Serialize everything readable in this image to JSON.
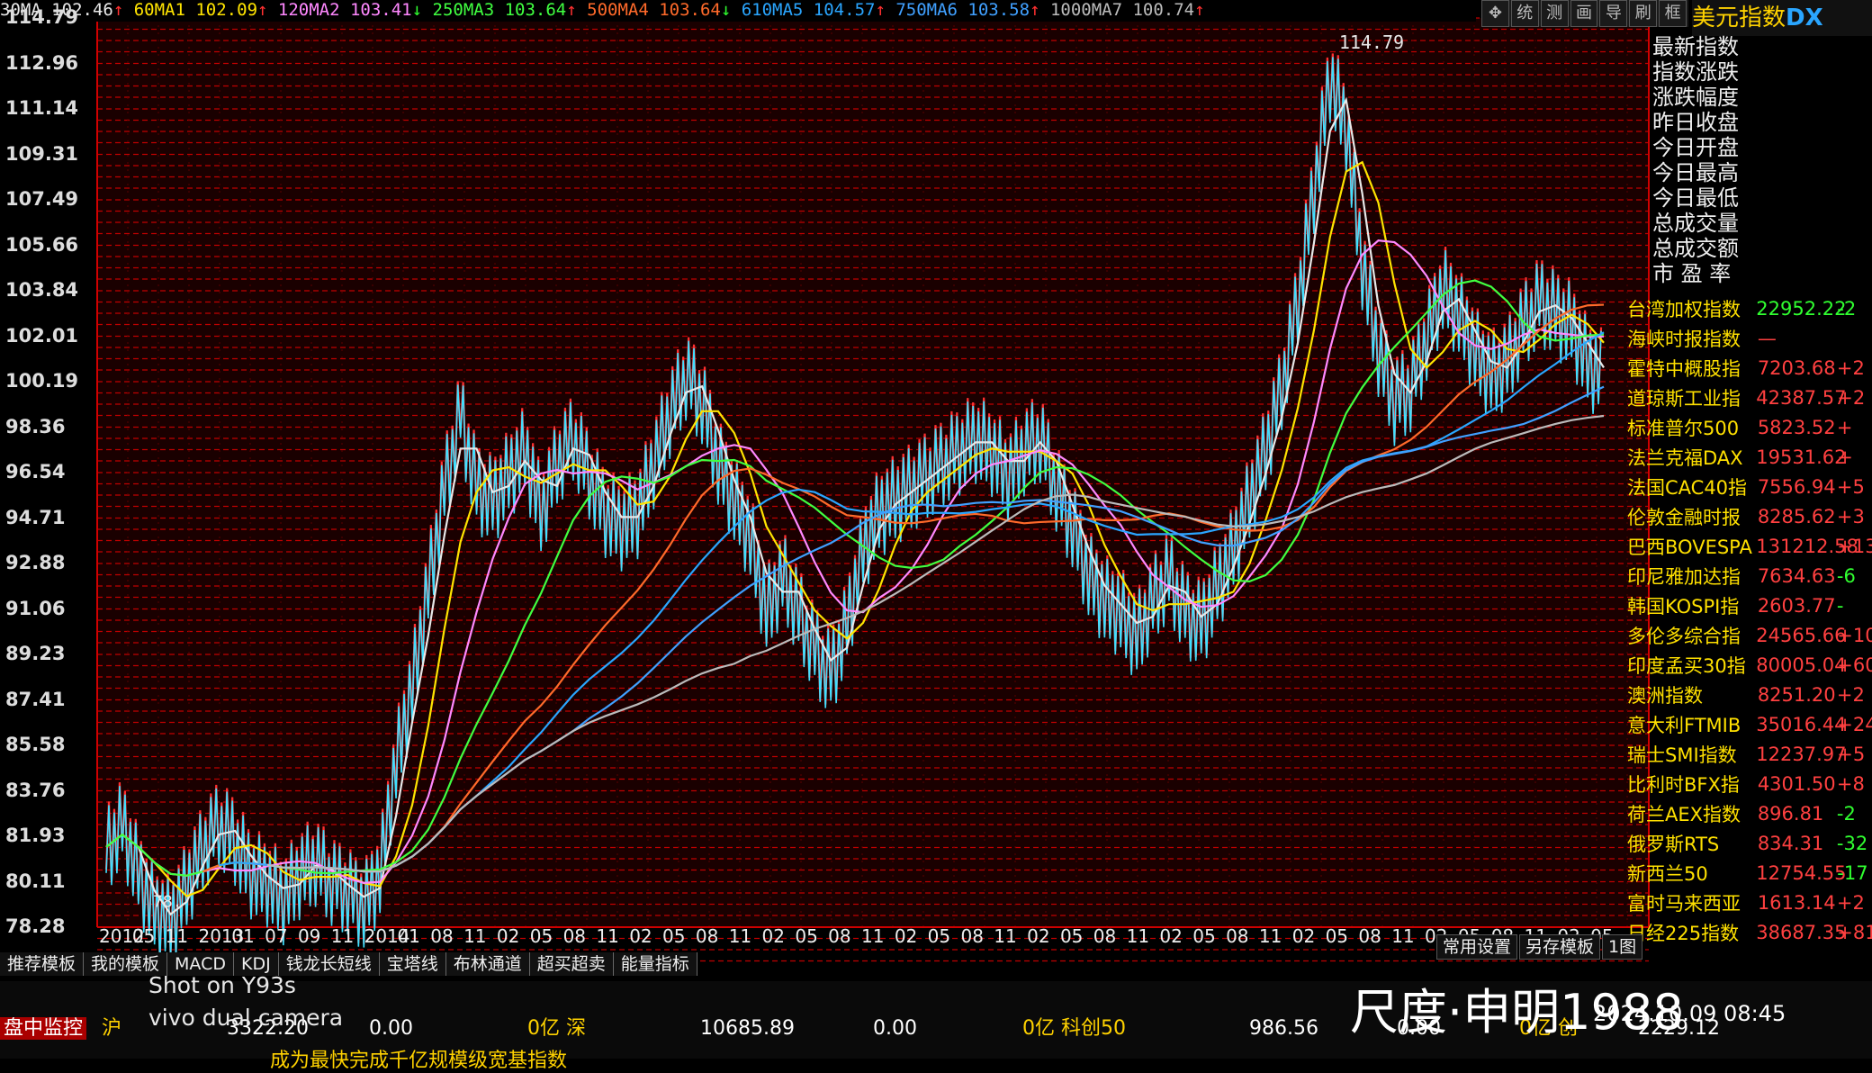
{
  "header": {
    "items": [
      {
        "label": "30MA",
        "value": "102.46",
        "arrow": "↑",
        "color": "#e8e8e8",
        "acolor": "#ff3030"
      },
      {
        "label": "60MA1",
        "value": "102.09",
        "arrow": "↑",
        "color": "#ffe400",
        "acolor": "#ff3030"
      },
      {
        "label": "120MA2",
        "value": "103.41",
        "arrow": "↓",
        "color": "#ff88ff",
        "acolor": "#30ff30"
      },
      {
        "label": "250MA3",
        "value": "103.64",
        "arrow": "↑",
        "color": "#40ff40",
        "acolor": "#ff3030"
      },
      {
        "label": "500MA4",
        "value": "103.64",
        "arrow": "↓",
        "color": "#ff6a2a",
        "acolor": "#30ff30"
      },
      {
        "label": "610MA5",
        "value": "104.57",
        "arrow": "↑",
        "color": "#2aa6ff",
        "acolor": "#ff3030"
      },
      {
        "label": "750MA6",
        "value": "103.58",
        "arrow": "↑",
        "color": "#40a0ff",
        "acolor": "#ff3030"
      },
      {
        "label": "1000MA7",
        "value": "100.74",
        "arrow": "↑",
        "color": "#bbbbbb",
        "acolor": "#ff3030"
      }
    ]
  },
  "toolbar": {
    "icons": [
      "move-icon",
      "统",
      "测",
      "画",
      "导",
      "刷",
      "框"
    ]
  },
  "index_title": {
    "name": "美元指数",
    "code": "DX"
  },
  "info_labels": [
    "最新指数",
    "指数涨跌",
    "涨跌幅度",
    "昨日收盘",
    "今日开盘",
    "今日最高",
    "今日最低",
    "总成交量",
    "总成交额",
    "市 盈 率"
  ],
  "watchlist": [
    {
      "name": "台湾加权指数",
      "value": "22952.22",
      "change": "-2"
    },
    {
      "name": "海峡时报指数",
      "value": "—",
      "change": ""
    },
    {
      "name": "霍特中概股指",
      "value": "7203.68",
      "change": "+2"
    },
    {
      "name": "道琼斯工业指",
      "value": "42387.57",
      "change": "+2"
    },
    {
      "name": "标准普尔500",
      "value": "5823.52",
      "change": "+"
    },
    {
      "name": "法兰克福DAX",
      "value": "19531.62",
      "change": "+"
    },
    {
      "name": "法国CAC40指",
      "value": "7556.94",
      "change": "+5"
    },
    {
      "name": "伦敦金融时报",
      "value": "8285.62",
      "change": "+3"
    },
    {
      "name": "巴西BOVESPA",
      "value": "131212.58",
      "change": "+13"
    },
    {
      "name": "印尼雅加达指",
      "value": "7634.63",
      "change": "-6"
    },
    {
      "name": "韩国KOSPI指",
      "value": "2603.77",
      "change": "-"
    },
    {
      "name": "多伦多综合指",
      "value": "24565.66",
      "change": "+10"
    },
    {
      "name": "印度孟买30指",
      "value": "80005.04",
      "change": "+60"
    },
    {
      "name": "澳洲指数",
      "value": "8251.20",
      "change": "+2"
    },
    {
      "name": "意大利FTMIB",
      "value": "35016.44",
      "change": "+24"
    },
    {
      "name": "瑞士SMI指数",
      "value": "12237.97",
      "change": "+5"
    },
    {
      "name": "比利时BFX指",
      "value": "4301.50",
      "change": "+8"
    },
    {
      "name": "荷兰AEX指数",
      "value": "896.81",
      "change": "-2"
    },
    {
      "name": "俄罗斯RTS",
      "value": "834.31",
      "change": "-32"
    },
    {
      "name": "新西兰50",
      "value": "12754.55",
      "change": "-17"
    },
    {
      "name": "富时马来西亚",
      "value": "1613.14",
      "change": "+2"
    },
    {
      "name": "日经225指数",
      "value": "38687.35",
      "change": "+81"
    }
  ],
  "chart_data": {
    "type": "line",
    "yticks": [
      "114.79",
      "112.96",
      "111.14",
      "109.31",
      "107.49",
      "105.66",
      "103.84",
      "102.01",
      "100.19",
      "98.36",
      "96.54",
      "94.71",
      "92.88",
      "91.06",
      "89.23",
      "87.41",
      "85.58",
      "83.76",
      "81.93",
      "80.11",
      "78.28"
    ],
    "ylim": [
      78.28,
      114.79
    ],
    "xticks": [
      "2012",
      "05",
      "11",
      "2013",
      "01",
      "07",
      "09",
      "11",
      "2014",
      "01",
      "08",
      "11",
      "02",
      "05",
      "08",
      "11",
      "02",
      "05",
      "08",
      "11",
      "02",
      "05",
      "08",
      "11",
      "02",
      "05",
      "08",
      "11",
      "02",
      "05",
      "08",
      "11",
      "02",
      "05",
      "08",
      "11",
      "02",
      "05",
      "08",
      "11",
      "02",
      "05",
      "08",
      "11",
      "02",
      "05"
    ],
    "peak_label": "114.79",
    "low_label": "78.",
    "price_closes": [
      81.5,
      82.5,
      80.5,
      79.0,
      78.6,
      80.0,
      81.5,
      82.5,
      81.8,
      80.5,
      80.2,
      79.5,
      80.5,
      81.0,
      80.2,
      79.8,
      79.2,
      80.5,
      85.0,
      88.0,
      92.0,
      96.0,
      99.0,
      96.0,
      95.5,
      96.5,
      97.5,
      95.0,
      97.0,
      98.0,
      96.5,
      95.0,
      94.5,
      95.0,
      97.0,
      99.0,
      100.5,
      99.5,
      97.0,
      95.5,
      94.0,
      91.0,
      92.5,
      91.0,
      89.5,
      88.5,
      90.5,
      93.5,
      95.0,
      95.5,
      96.0,
      96.5,
      97.0,
      97.5,
      98.0,
      97.5,
      96.5,
      97.5,
      98.0,
      96.0,
      94.5,
      92.5,
      91.5,
      91.0,
      90.0,
      91.5,
      92.5,
      91.0,
      90.5,
      92.0,
      93.5,
      95.5,
      97.5,
      100.0,
      103.5,
      108.0,
      112.5,
      110.5,
      105.0,
      101.5,
      99.5,
      100.0,
      102.0,
      104.0,
      103.0,
      101.5,
      100.5,
      101.0,
      102.5,
      103.5,
      103.0,
      102.5,
      101.0,
      100.5
    ],
    "series": [
      {
        "name": "30MA",
        "color": "#e8e8e8",
        "values": []
      },
      {
        "name": "60MA1",
        "color": "#ffe400",
        "values": []
      },
      {
        "name": "120MA2",
        "color": "#ff88ff",
        "values": []
      },
      {
        "name": "250MA3",
        "color": "#40ff40",
        "values": []
      },
      {
        "name": "500MA4",
        "color": "#ff6a2a",
        "values": []
      },
      {
        "name": "610MA5",
        "color": "#2aa6ff",
        "values": []
      },
      {
        "name": "750MA6",
        "color": "#40a0ff",
        "values": []
      },
      {
        "name": "1000MA7",
        "color": "#bbbbbb",
        "values": []
      }
    ]
  },
  "tabs": [
    "推荐模板",
    "我的模板",
    "MACD",
    "KDJ",
    "钱龙长短线",
    "宝塔线",
    "布林通道",
    "超买超卖",
    "能量指标"
  ],
  "tabs_right": [
    "常用设置",
    "另存模板",
    "1图"
  ],
  "status": {
    "monitor": "盘中监控",
    "sh_label": "沪",
    "sh_value": "3322.20",
    "sh_chg": "0.00",
    "sh_amt": "0亿",
    "sz_label": "深",
    "sz_value": "10685.89",
    "sz_chg": "0.00",
    "sz_amt": "0亿",
    "kc_label": "科创50",
    "kc_value": "986.56",
    "kc_chg": "0.00",
    "kc_amt": "0亿",
    "cy_label": "创",
    "cy_value": "2229.12",
    "ticker": "成为最快完成千亿规模级宽基指数"
  },
  "overlays": {
    "shot": "Shot on Y93s",
    "camera": "vivo dual camera",
    "brand": "尺度·申明1988",
    "date": "2024.10.09 08:45"
  }
}
